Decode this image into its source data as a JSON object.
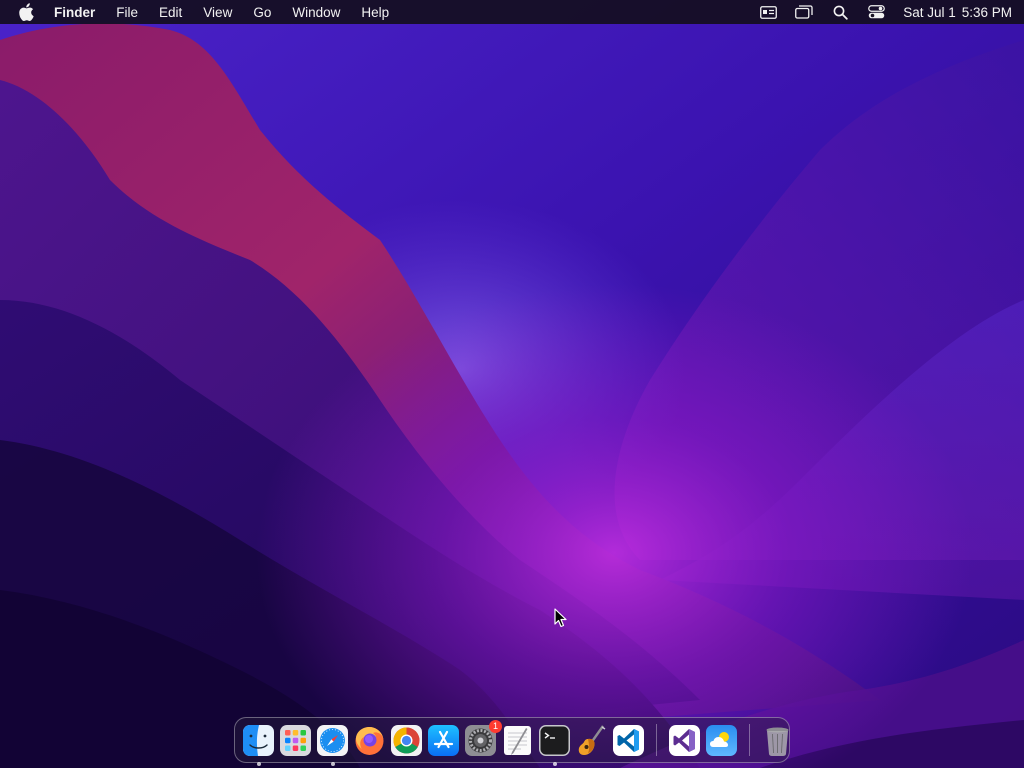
{
  "menubar": {
    "apple_icon": "apple-logo-icon",
    "app_name": "Finder",
    "menus": [
      "File",
      "Edit",
      "View",
      "Go",
      "Window",
      "Help"
    ],
    "status_icons": [
      "keyboard-input-icon",
      "screen-mirroring-icon",
      "spotlight-search-icon",
      "control-center-icon"
    ],
    "date": "Sat Jul 1",
    "time": "5:36 PM"
  },
  "dock": {
    "apps": [
      {
        "name": "Finder",
        "icon": "finder-icon",
        "running": true
      },
      {
        "name": "Launchpad",
        "icon": "launchpad-icon",
        "running": false
      },
      {
        "name": "Safari",
        "icon": "safari-icon",
        "running": true
      },
      {
        "name": "Firefox",
        "icon": "firefox-icon",
        "running": false
      },
      {
        "name": "Google Chrome",
        "icon": "chrome-icon",
        "running": false
      },
      {
        "name": "App Store",
        "icon": "app-store-icon",
        "running": false
      },
      {
        "name": "System Preferences",
        "icon": "system-preferences-icon",
        "running": false,
        "badge": "1"
      },
      {
        "name": "TextEdit",
        "icon": "textedit-icon",
        "running": false
      },
      {
        "name": "Terminal",
        "icon": "terminal-icon",
        "running": true
      },
      {
        "name": "GarageBand",
        "icon": "garageband-icon",
        "running": false
      },
      {
        "name": "Visual Studio Code",
        "icon": "vscode-icon",
        "running": false
      }
    ],
    "recent_apps": [
      {
        "name": "Visual Studio",
        "icon": "visual-studio-icon"
      },
      {
        "name": "Weather",
        "icon": "weather-icon"
      }
    ],
    "trash": {
      "name": "Trash",
      "icon": "trash-icon"
    }
  },
  "colors": {
    "wallpaper_primary": "#3a12a8",
    "wallpaper_magenta": "#8a18c8",
    "wallpaper_red": "#b0264e",
    "badge": "#ff3b30"
  }
}
